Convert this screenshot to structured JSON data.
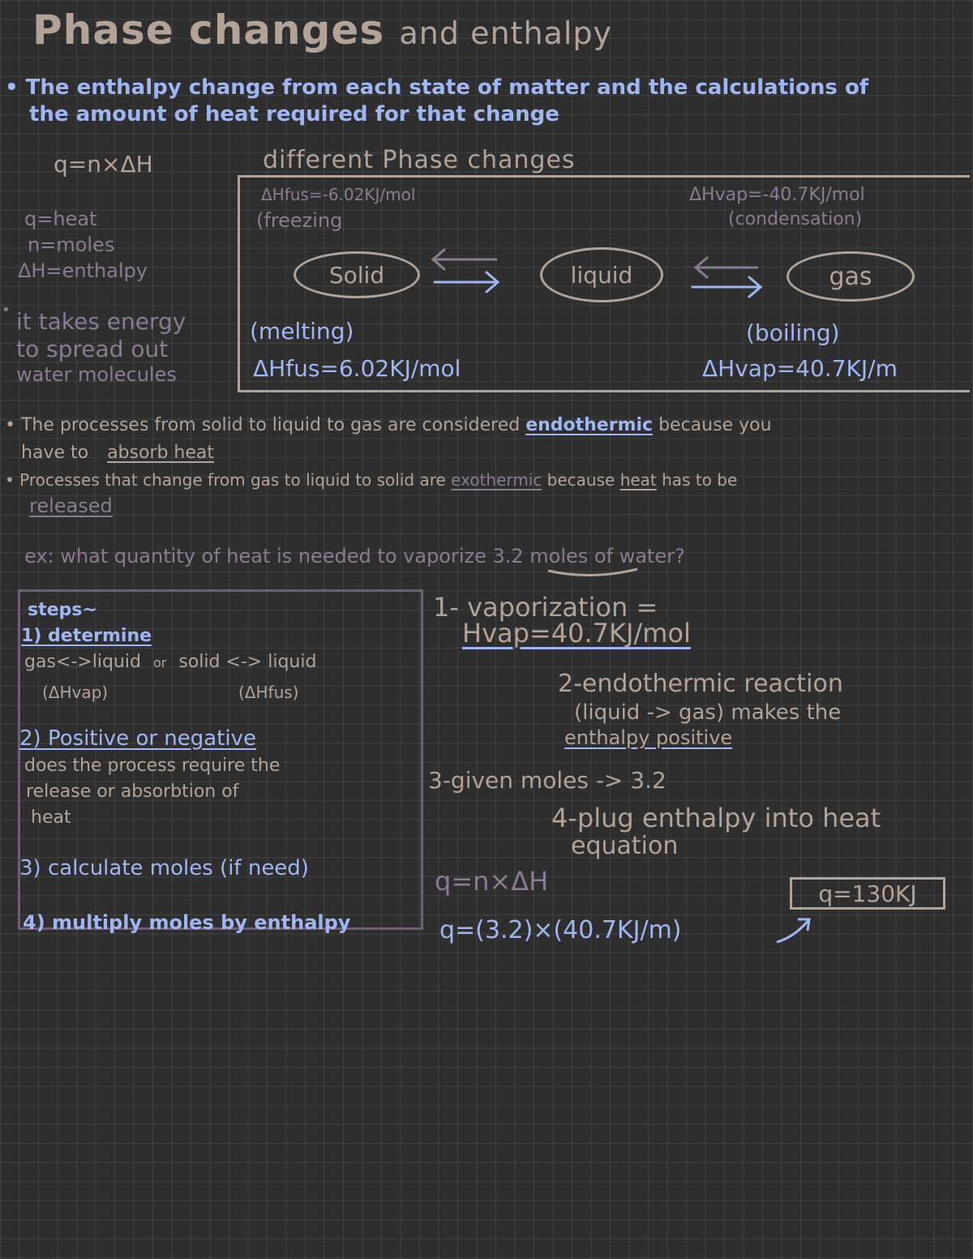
{
  "title": {
    "main": "Phase changes",
    "sub": "and enthalpy"
  },
  "intro": {
    "line1": "The enthalpy change from each state of matter and the calculations of",
    "line2": "the amount of heat required for that change"
  },
  "equation": "q=n×ΔH",
  "legend": {
    "q": "q=heat",
    "n": "n=moles",
    "dh": "ΔH=enthalpy"
  },
  "energy_note": {
    "line1": "it takes energy",
    "line2": "to spread out",
    "line3": "water molecules"
  },
  "diagram": {
    "title": "different Phase changes",
    "freezing_dh": "ΔHfus=-6.02KJ/mol",
    "freezing": "(freezing",
    "condensation_dh": "ΔHvap=-40.7KJ/mol",
    "condensation": "(condensation)",
    "solid": "Solid",
    "liquid": "liquid",
    "gas": "gas",
    "melting": "(melting)",
    "melting_dh": "ΔHfus=6.02KJ/mol",
    "boiling": "(boiling)",
    "boiling_dh": "ΔHvap=40.7KJ/m"
  },
  "endo": {
    "pre": "The processes from solid to liquid to gas are considered ",
    "key": "endothermic",
    "post": " because you",
    "line2_pre": "have to ",
    "line2_key": "absorb heat"
  },
  "exo": {
    "pre": "Processes that change from gas to liquid to solid are ",
    "key": "exothermic",
    "mid": " because ",
    "key2": "heat",
    "post": " has to be",
    "line2_key": "released"
  },
  "example": "ex: what quantity of heat is needed to vaporize 3.2 moles of water?",
  "steps": {
    "title": "steps~",
    "s1": "1) determine",
    "s1a": "gas<->liquid",
    "s1or": "or",
    "s1b": "solid <-> liquid",
    "s1a_dh": "(ΔHvap)",
    "s1b_dh": "(ΔHfus)",
    "s2": "2) Positive or negative",
    "s2a": "does the process require the",
    "s2b": "release or absorbtion of",
    "s2c": "heat",
    "s3": "3) calculate moles (if need)",
    "s4": "4) multiply moles by enthalpy"
  },
  "solution": {
    "l1": "1- vaporization =",
    "l1b": "Hvap=40.7KJ/mol",
    "l2": "2-endothermic reaction",
    "l2a": "(liquid -> gas) makes the",
    "l2b": "enthalpy positive",
    "l3": "3-given moles -> 3.2",
    "l4": "4-plug enthalpy into heat",
    "l4b": "equation",
    "eq": "q=n×ΔH",
    "calc": "q=(3.2)×(40.7KJ/m)",
    "answer": "q=130KJ"
  }
}
